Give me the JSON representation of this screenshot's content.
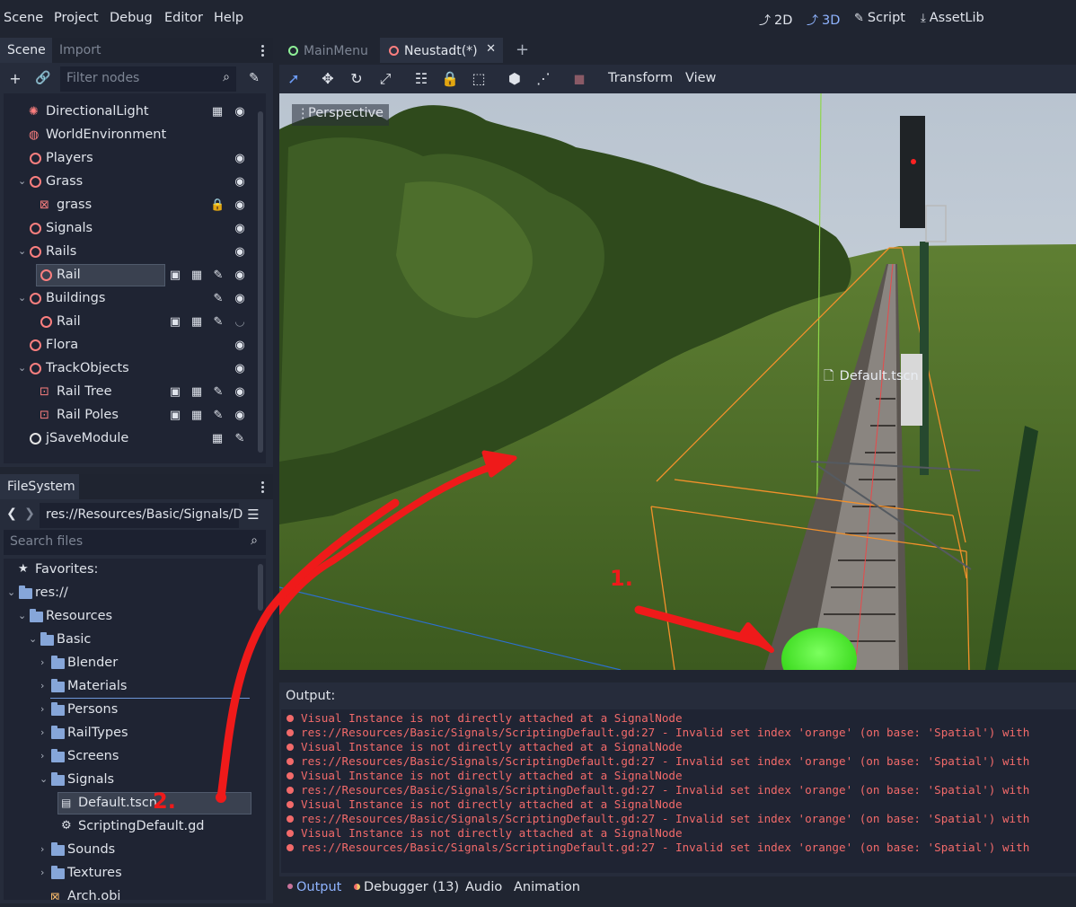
{
  "menu": {
    "items": [
      "Scene",
      "Project",
      "Debug",
      "Editor",
      "Help"
    ],
    "workspaces": [
      {
        "label": "2D",
        "icon": "2d-icon",
        "active": false
      },
      {
        "label": "3D",
        "icon": "3d-icon",
        "active": true
      },
      {
        "label": "Script",
        "icon": "script-icon",
        "active": false
      },
      {
        "label": "AssetLib",
        "icon": "assetlib-icon",
        "active": false
      }
    ]
  },
  "scene_dock": {
    "tabs": [
      "Scene",
      "Import"
    ],
    "filter_placeholder": "Filter nodes",
    "nodes": [
      {
        "label": "DirectionalLight"
      },
      {
        "label": "WorldEnvironment"
      },
      {
        "label": "Players"
      },
      {
        "label": "Grass"
      },
      {
        "label": "grass"
      },
      {
        "label": "Signals"
      },
      {
        "label": "Rails"
      },
      {
        "label": "Rail"
      },
      {
        "label": "Buildings"
      },
      {
        "label": "Rail"
      },
      {
        "label": "Flora"
      },
      {
        "label": "TrackObjects"
      },
      {
        "label": "Rail Tree"
      },
      {
        "label": "Rail Poles"
      },
      {
        "label": "jSaveModule"
      }
    ]
  },
  "filesystem": {
    "tab": "FileSystem",
    "path": "res://Resources/Basic/Signals/D",
    "search_placeholder": "Search files",
    "items": [
      {
        "label": "Favorites:"
      },
      {
        "label": "res://"
      },
      {
        "label": "Resources"
      },
      {
        "label": "Basic"
      },
      {
        "label": "Blender"
      },
      {
        "label": "Materials"
      },
      {
        "label": "Persons"
      },
      {
        "label": "RailTypes"
      },
      {
        "label": "Screens"
      },
      {
        "label": "Signals"
      },
      {
        "label": "Default.tscn"
      },
      {
        "label": "ScriptingDefault.gd"
      },
      {
        "label": "Sounds"
      },
      {
        "label": "Textures"
      },
      {
        "label": "Arch.obj"
      }
    ]
  },
  "editor": {
    "tabs": [
      {
        "label": "MainMenu",
        "color": "#8eef97",
        "active": false
      },
      {
        "label": "Neustadt(*)",
        "color": "#fc7f7f",
        "active": true
      }
    ],
    "toolbar_menus": [
      "Transform",
      "View"
    ],
    "viewport_label": "Perspective",
    "scene_label": "Default.tscn",
    "annotations": [
      "1.",
      "2."
    ]
  },
  "output": {
    "title": "Output:",
    "lines": [
      "Visual Instance is not directly attached at a SignalNode",
      "res://Resources/Basic/Signals/ScriptingDefault.gd:27 - Invalid set index 'orange' (on base: 'Spatial') with",
      "Visual Instance is not directly attached at a SignalNode",
      "res://Resources/Basic/Signals/ScriptingDefault.gd:27 - Invalid set index 'orange' (on base: 'Spatial') with",
      "Visual Instance is not directly attached at a SignalNode",
      "res://Resources/Basic/Signals/ScriptingDefault.gd:27 - Invalid set index 'orange' (on base: 'Spatial') with",
      "Visual Instance is not directly attached at a SignalNode",
      "res://Resources/Basic/Signals/ScriptingDefault.gd:27 - Invalid set index 'orange' (on base: 'Spatial') with",
      "Visual Instance is not directly attached at a SignalNode",
      "res://Resources/Basic/Signals/ScriptingDefault.gd:27 - Invalid set index 'orange' (on base: 'Spatial') with"
    ]
  },
  "bottom_tabs": [
    "Output",
    "Debugger (13)",
    "Audio",
    "Animation"
  ]
}
